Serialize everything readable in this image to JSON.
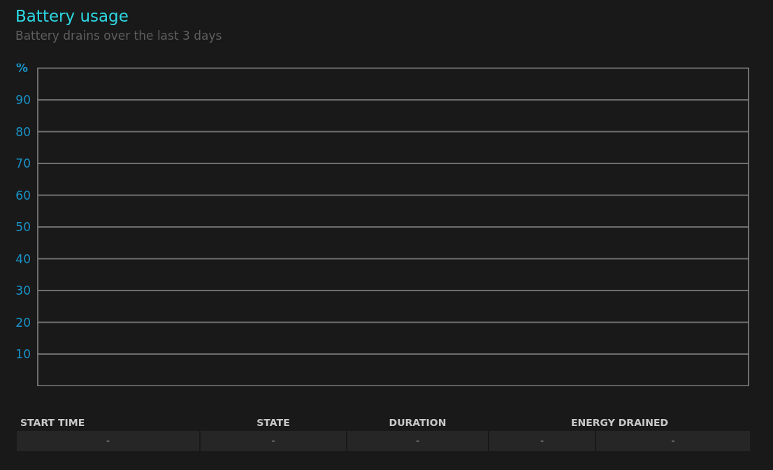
{
  "title": "Battery usage",
  "subtitle": "Battery drains over the last 3 days",
  "chart": {
    "unit_label": "%",
    "y_labels": [
      "90",
      "80",
      "70",
      "60",
      "50",
      "40",
      "30",
      "20",
      "10"
    ]
  },
  "table": {
    "columns": [
      {
        "label": "START TIME"
      },
      {
        "label": "STATE"
      },
      {
        "label": "DURATION"
      },
      {
        "label": "ENERGY DRAINED"
      }
    ],
    "rows": [
      [
        "-",
        "-",
        "-",
        "-",
        "-"
      ]
    ]
  }
}
